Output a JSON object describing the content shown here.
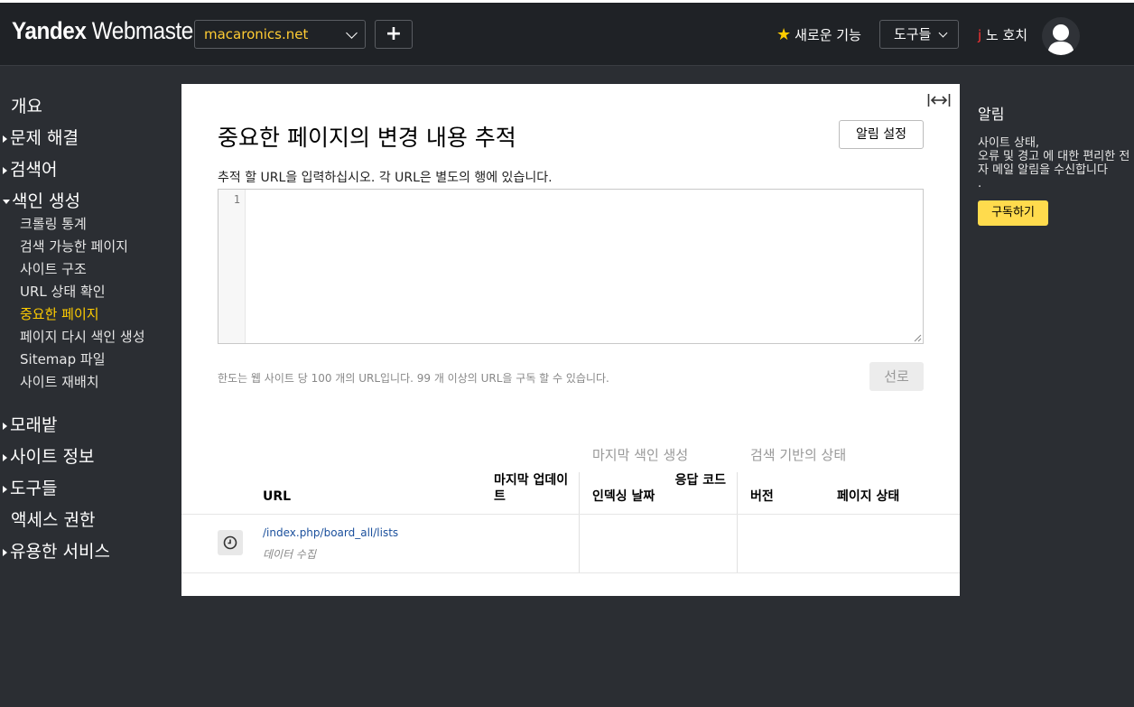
{
  "header": {
    "logo_brand": "Yandex",
    "logo_product": " Webmaster",
    "site_selector": "macaronics.net",
    "add_label": "+",
    "new_features": "새로운 기능",
    "tools": "도구들",
    "user_first": "j",
    "user_rest": " 노 호치"
  },
  "sidebar": {
    "overview": "개요",
    "troubleshooting": "문제 해결",
    "search_queries": "검색어",
    "indexing": "색인 생성",
    "indexing_items": [
      "크롤링 통계",
      "검색 가능한 페이지",
      "사이트 구조",
      "URL 상태 확인",
      "중요한 페이지",
      "페이지 다시 색인 생성",
      "Sitemap 파일",
      "사이트 재배치"
    ],
    "sandbox": "모래밭",
    "site_info": "사이트 정보",
    "tools": "도구들",
    "access": "액세스 권한",
    "useful_services": "유용한 서비스"
  },
  "main": {
    "title": "중요한 페이지의 변경 내용 추적",
    "alert_settings": "알림 설정",
    "instructions": "추적 할 URL을 입력하십시오. 각 URL은 별도의 행에 있습니다.",
    "editor_line": "1",
    "limit_note": "한도는 웹 사이트 당 100 개의 URL입니다. 99 개 이상의 URL을 구독 할 수 있습니다.",
    "select_button": "선로",
    "table": {
      "group_last_indexing": "마지막 색인 생성",
      "group_search_status": "검색 기반의 상태",
      "col_url": "URL",
      "col_last_update": "마지막 업데이트",
      "col_indexing_date": "인덱싱 날짜",
      "col_response_code": "응답 코드",
      "col_version": "버전",
      "col_page_status": "페이지 상태",
      "rows": [
        {
          "url": "/index.php/board_all/lists",
          "status": "데이터 수집"
        }
      ]
    }
  },
  "right_panel": {
    "title": "알림",
    "desc_line1": "사이트 상태,",
    "desc_line2": "오류 및 경고 에 대한 편리한 전자 메일 알림을 수신합니다",
    "desc_line3": ".",
    "subscribe": "구독하기"
  },
  "colors": {
    "accent_yellow": "#ffcc00",
    "background": "#2b2e33",
    "link_blue": "#1a4f9c",
    "button_yellow": "#ffdb4d"
  }
}
